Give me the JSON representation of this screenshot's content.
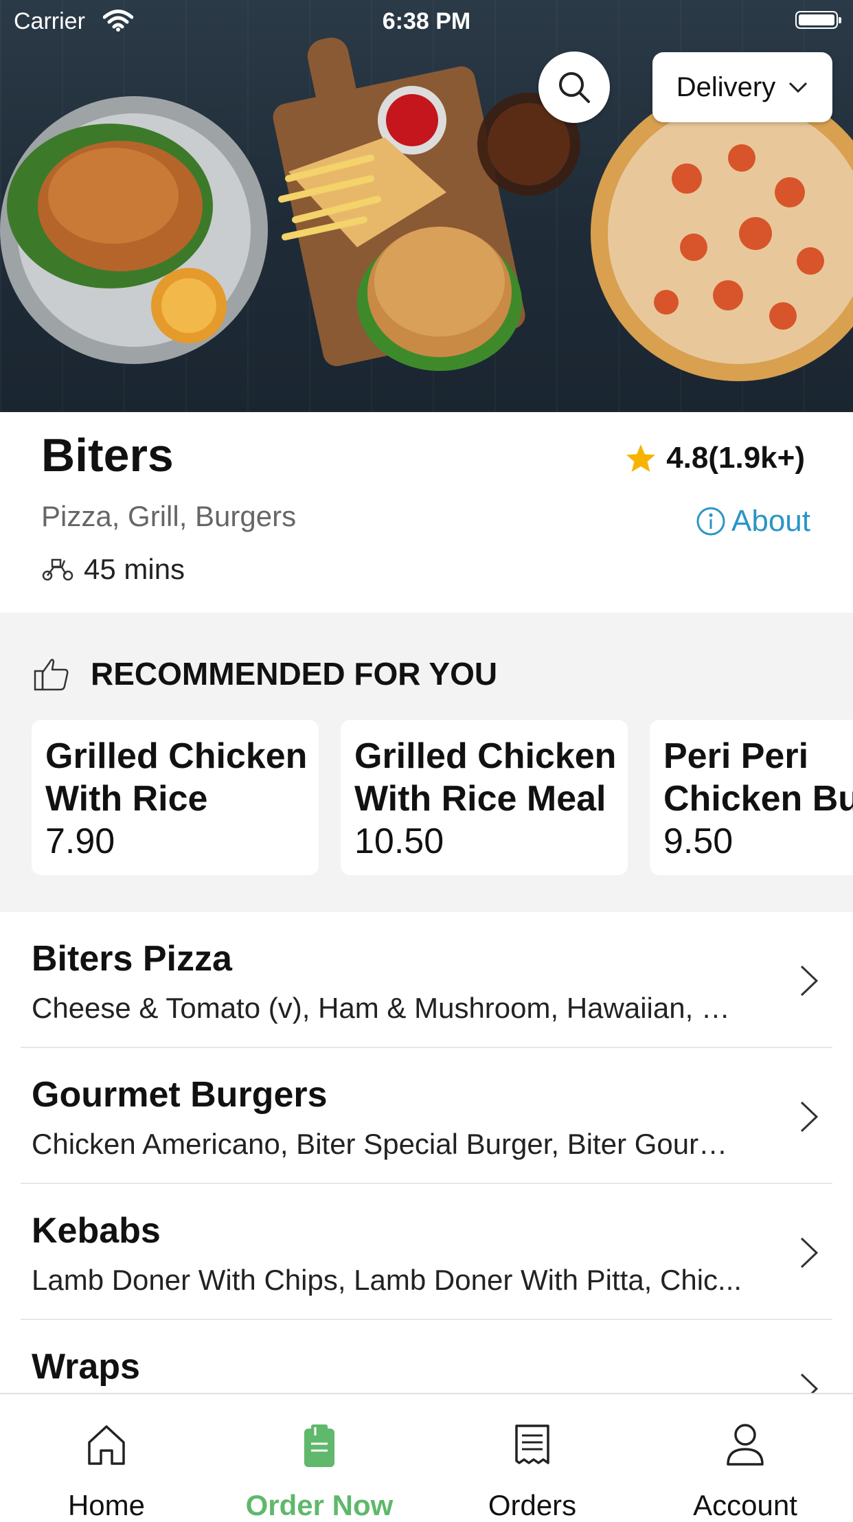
{
  "status_bar": {
    "carrier": "Carrier",
    "time": "6:38 PM"
  },
  "header": {
    "delivery_mode": "Delivery"
  },
  "restaurant": {
    "name": "Biters",
    "rating": "4.8(1.9k+)",
    "cuisine": "Pizza, Grill, Burgers",
    "about_label": "About",
    "delivery_time": "45 mins"
  },
  "recommended": {
    "title": "RECOMMENDED FOR YOU",
    "items": [
      {
        "name_line1": "Grilled Chicken",
        "name_line2": "With Rice",
        "price": "7.90"
      },
      {
        "name_line1": "Grilled Chicken",
        "name_line2": "With Rice Meal",
        "price": "10.50"
      },
      {
        "name_line1": "Peri Peri",
        "name_line2": "Chicken Burger",
        "price": "9.50"
      }
    ]
  },
  "menu": {
    "categories": [
      {
        "title": "Biters Pizza",
        "desc": "Cheese & Tomato (v), Ham & Mushroom, Hawaiian, Be..."
      },
      {
        "title": "Gourmet Burgers",
        "desc": "Chicken Americano, Biter Special Burger, Biter Gourm..."
      },
      {
        "title": "Kebabs",
        "desc": "Lamb Doner With Chips, Lamb Doner With Pitta, Chic..."
      },
      {
        "title": "Wraps",
        "desc": ""
      }
    ]
  },
  "tabbar": {
    "tabs": [
      {
        "label": "Home",
        "icon": "home-icon"
      },
      {
        "label": "Order Now",
        "icon": "order-now-icon",
        "active": true
      },
      {
        "label": "Orders",
        "icon": "receipt-icon"
      },
      {
        "label": "Account",
        "icon": "account-icon"
      }
    ]
  },
  "colors": {
    "accent_green": "#5fb86b",
    "link_blue": "#2a95c5",
    "star_yellow": "#f6b400"
  }
}
